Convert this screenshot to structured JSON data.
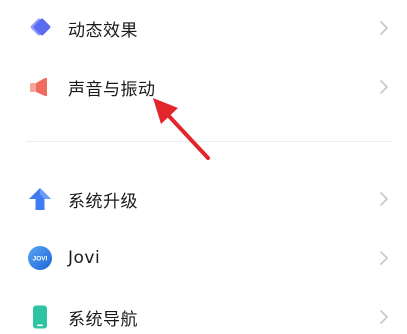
{
  "settings": {
    "items": [
      {
        "label": "动态效果",
        "icon": "dynamic-effects-icon",
        "color": "#5b6cf0"
      },
      {
        "label": "声音与振动",
        "icon": "speaker-icon",
        "color": "#f06a5e"
      },
      {
        "label": "系统升级",
        "icon": "upgrade-arrow-icon",
        "color": "#3f7bf2"
      },
      {
        "label": "Jovi",
        "icon": "jovi-icon",
        "color": "#2f7de1",
        "badge": "JOVI"
      },
      {
        "label": "系统导航",
        "icon": "phone-navigation-icon",
        "color": "#2ec4a2"
      }
    ]
  },
  "annotation": {
    "arrow_color": "#e2262b"
  }
}
